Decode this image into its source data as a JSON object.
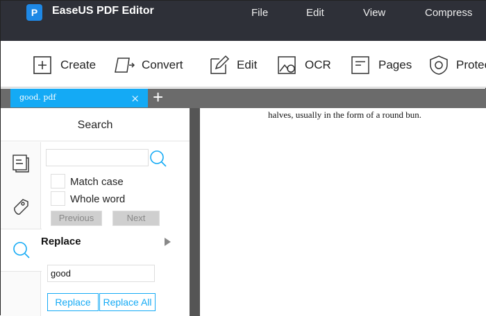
{
  "app": {
    "title": "EaseUS PDF Editor",
    "logo_letter": "P"
  },
  "menu": [
    "File",
    "Edit",
    "View",
    "Compress"
  ],
  "toolbar": {
    "create": "Create",
    "convert": "Convert",
    "edit": "Edit",
    "ocr": "OCR",
    "pages": "Pages",
    "protect": "Protect"
  },
  "tabs": [
    {
      "label": "good. pdf"
    }
  ],
  "tab_icons": {
    "close": "×",
    "add": "+"
  },
  "panel": {
    "title": "Search",
    "search_value": "",
    "match_case": "Match case",
    "whole_word": "Whole word",
    "previous": "Previous",
    "next": "Next",
    "replace_heading": "Replace",
    "replace_value": "good",
    "replace": "Replace",
    "replace_all": "Replace All"
  },
  "document": {
    "text": "halves, usually in the form of a round bun."
  },
  "colors": {
    "accent": "#14aaf5",
    "titlebar": "#2e3038"
  }
}
